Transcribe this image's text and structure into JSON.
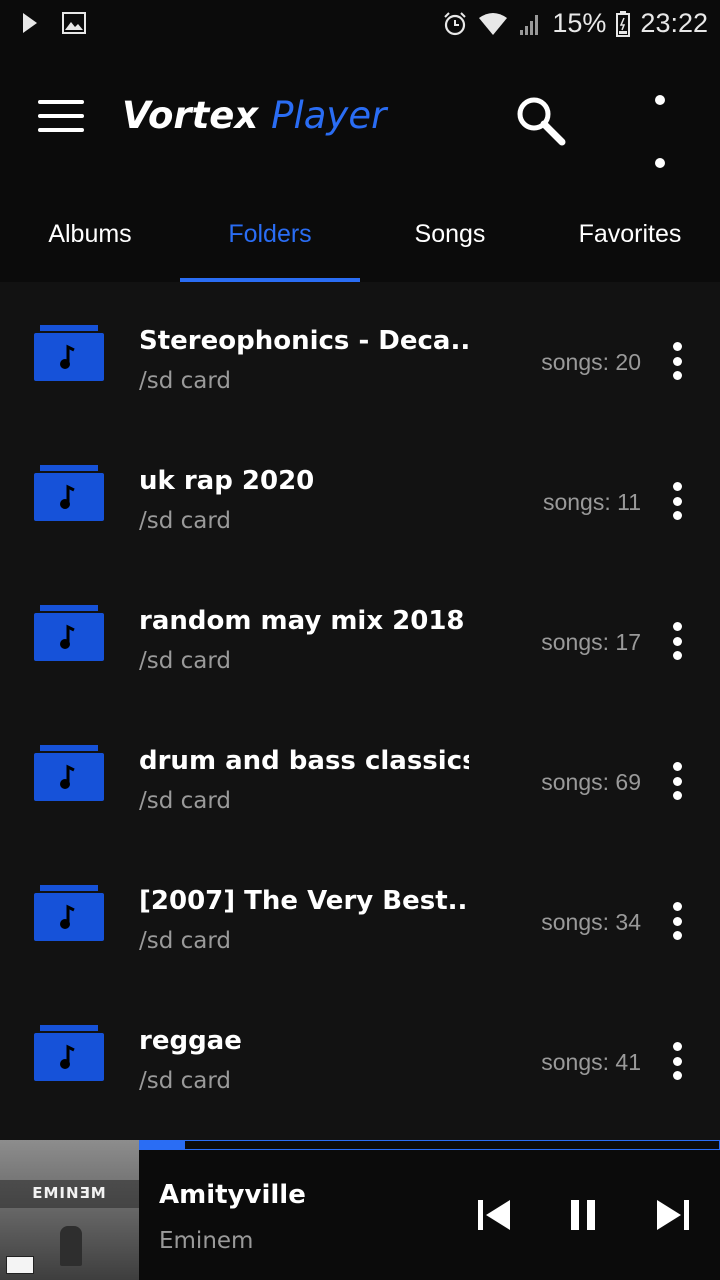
{
  "status_bar": {
    "battery": "15%",
    "time": "23:22",
    "icons": [
      "play-notification-icon",
      "image-notification-icon",
      "alarm-icon",
      "wifi-icon",
      "signal-icon",
      "battery-icon"
    ]
  },
  "header": {
    "title_part1": "Vortex",
    "title_part2": "Player",
    "icons": [
      "menu-icon",
      "search-icon",
      "more-vert-icon"
    ]
  },
  "tabs": [
    {
      "label": "Albums",
      "active": false
    },
    {
      "label": "Folders",
      "active": true
    },
    {
      "label": "Songs",
      "active": false
    },
    {
      "label": "Favorites",
      "active": false
    }
  ],
  "folders": [
    {
      "name": "Stereophonics - Deca...",
      "path": "/sd card",
      "count": "songs: 20"
    },
    {
      "name": "uk rap 2020",
      "path": "/sd card",
      "count": "songs: 11"
    },
    {
      "name": "random may mix 2018",
      "path": "/sd card",
      "count": "songs: 17"
    },
    {
      "name": "drum and bass classics",
      "path": "/sd card",
      "count": "songs: 69"
    },
    {
      "name": "[2007] The Very Best...",
      "path": "/sd card",
      "count": "songs: 34"
    },
    {
      "name": "reggae",
      "path": "/sd card",
      "count": "songs: 41"
    }
  ],
  "now_playing": {
    "title": "Amityville",
    "artist": "Eminem",
    "album_art_text": "EMINƎM",
    "progress": 0.08,
    "controls": [
      "skip-previous-icon",
      "pause-icon",
      "skip-next-icon"
    ]
  },
  "colors": {
    "accent": "#2a6df4",
    "folder_icon": "#1652d9",
    "background": "#121212",
    "bar_background": "#0b0b0b",
    "secondary_text": "#9a9a9a"
  }
}
